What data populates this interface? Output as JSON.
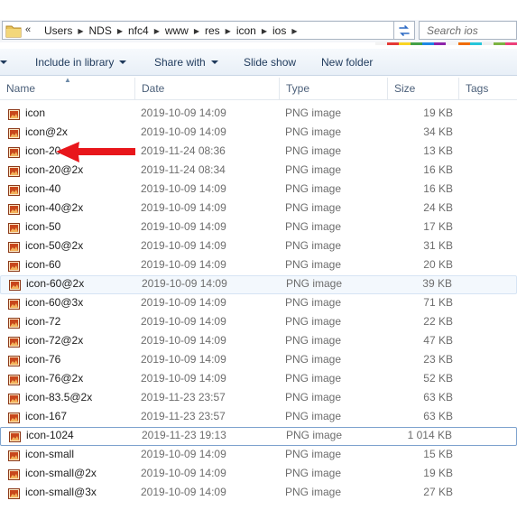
{
  "address_bar": {
    "overflow_glyph": "«",
    "breadcrumbs": [
      "Users",
      "NDS",
      "nfc4",
      "www",
      "res",
      "icon",
      "ios"
    ]
  },
  "search": {
    "placeholder": "Search ios"
  },
  "toolbar": {
    "include_in_library": "Include in library",
    "share_with": "Share with",
    "slide_show": "Slide show",
    "new_folder": "New folder"
  },
  "columns": {
    "name": "Name",
    "date": "Date",
    "type": "Type",
    "size": "Size",
    "tags": "Tags"
  },
  "files": [
    {
      "name": "icon",
      "date": "2019-10-09 14:09",
      "type": "PNG image",
      "size": "19 KB"
    },
    {
      "name": "icon@2x",
      "date": "2019-10-09 14:09",
      "type": "PNG image",
      "size": "34 KB"
    },
    {
      "name": "icon-20",
      "date": "2019-11-24 08:36",
      "type": "PNG image",
      "size": "13 KB"
    },
    {
      "name": "icon-20@2x",
      "date": "2019-11-24 08:34",
      "type": "PNG image",
      "size": "16 KB"
    },
    {
      "name": "icon-40",
      "date": "2019-10-09 14:09",
      "type": "PNG image",
      "size": "16 KB"
    },
    {
      "name": "icon-40@2x",
      "date": "2019-10-09 14:09",
      "type": "PNG image",
      "size": "24 KB"
    },
    {
      "name": "icon-50",
      "date": "2019-10-09 14:09",
      "type": "PNG image",
      "size": "17 KB"
    },
    {
      "name": "icon-50@2x",
      "date": "2019-10-09 14:09",
      "type": "PNG image",
      "size": "31 KB"
    },
    {
      "name": "icon-60",
      "date": "2019-10-09 14:09",
      "type": "PNG image",
      "size": "20 KB"
    },
    {
      "name": "icon-60@2x",
      "date": "2019-10-09 14:09",
      "type": "PNG image",
      "size": "39 KB"
    },
    {
      "name": "icon-60@3x",
      "date": "2019-10-09 14:09",
      "type": "PNG image",
      "size": "71 KB"
    },
    {
      "name": "icon-72",
      "date": "2019-10-09 14:09",
      "type": "PNG image",
      "size": "22 KB"
    },
    {
      "name": "icon-72@2x",
      "date": "2019-10-09 14:09",
      "type": "PNG image",
      "size": "47 KB"
    },
    {
      "name": "icon-76",
      "date": "2019-10-09 14:09",
      "type": "PNG image",
      "size": "23 KB"
    },
    {
      "name": "icon-76@2x",
      "date": "2019-10-09 14:09",
      "type": "PNG image",
      "size": "52 KB"
    },
    {
      "name": "icon-83.5@2x",
      "date": "2019-11-23 23:57",
      "type": "PNG image",
      "size": "63 KB"
    },
    {
      "name": "icon-167",
      "date": "2019-11-23 23:57",
      "type": "PNG image",
      "size": "63 KB"
    },
    {
      "name": "icon-1024",
      "date": "2019-11-23 19:13",
      "type": "PNG image",
      "size": "1 014 KB"
    },
    {
      "name": "icon-small",
      "date": "2019-10-09 14:09",
      "type": "PNG image",
      "size": "15 KB"
    },
    {
      "name": "icon-small@2x",
      "date": "2019-10-09 14:09",
      "type": "PNG image",
      "size": "19 KB"
    },
    {
      "name": "icon-small@3x",
      "date": "2019-10-09 14:09",
      "type": "PNG image",
      "size": "27 KB"
    }
  ],
  "hovered_file": "icon-60@2x",
  "focused_file": "icon-1024",
  "annotation": {
    "arrow_target": "icon-20",
    "arrow_color": "#e8161b"
  },
  "colors": {
    "toolbar_text": "#1e395b",
    "header_text": "#4c607a",
    "secondary_text": "#6d6d6d",
    "focus_border": "#7da2ce",
    "hover_bg": "#f3f8fd"
  },
  "icons": {
    "folder": "folder-icon",
    "back_forward": "double-chevron-icon",
    "refresh": "refresh-icon",
    "organize": "dropdown-caret-icon",
    "file": "png-image-icon",
    "sort": "sort-ascending-icon"
  }
}
